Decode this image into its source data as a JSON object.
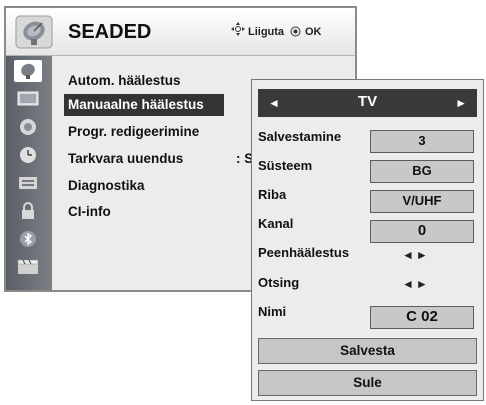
{
  "main_menu": {
    "title": "SEADED",
    "hint_move": "Liiguta",
    "hint_ok": "OK",
    "items": [
      {
        "label": "Autom. häälestus"
      },
      {
        "label": "Manuaalne häälestus"
      },
      {
        "label": "Progr. redigeerimine"
      },
      {
        "label": "Tarkvara uuendus"
      },
      {
        "label": "Diagnostika"
      },
      {
        "label": "CI-info"
      }
    ],
    "update_value_fragment": ": Se",
    "category_icons": [
      "setup-icon",
      "picture-icon",
      "audio-icon",
      "time-icon",
      "lock-icon",
      "option-icon",
      "bluetooth-icon",
      "media-icon"
    ]
  },
  "sub_panel": {
    "title": "TV",
    "rows": [
      {
        "label": "Salvestamine",
        "value": "3"
      },
      {
        "label": "Süsteem",
        "value": "BG"
      },
      {
        "label": "Riba",
        "value": "V/UHF"
      },
      {
        "label": "Kanal",
        "value": "0"
      },
      {
        "label": "Peenhäälestus",
        "value": "◄►"
      },
      {
        "label": "Otsing",
        "value": "◄►"
      },
      {
        "label": "Nimi",
        "value": "C 02"
      }
    ],
    "save_button": "Salvesta",
    "close_button": "Sule"
  }
}
